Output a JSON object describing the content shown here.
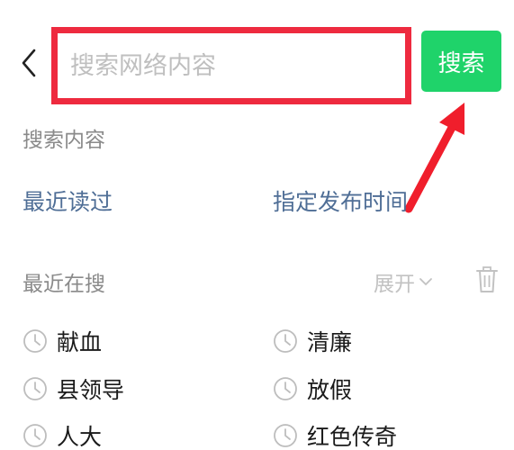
{
  "search": {
    "placeholder": "搜索网络内容",
    "button_label": "搜索"
  },
  "section": {
    "label": "搜索内容"
  },
  "filters": {
    "recent_read": "最近读过",
    "publish_time": "指定发布时间"
  },
  "recent": {
    "title": "最近在搜",
    "expand_label": "展开",
    "items": [
      "献血",
      "清廉",
      "县领导",
      "放假",
      "人大",
      "红色传奇"
    ]
  },
  "colors": {
    "accent_green": "#1fd36a",
    "highlight_red": "#ee2a3f",
    "link_blue": "#4f6e96"
  }
}
